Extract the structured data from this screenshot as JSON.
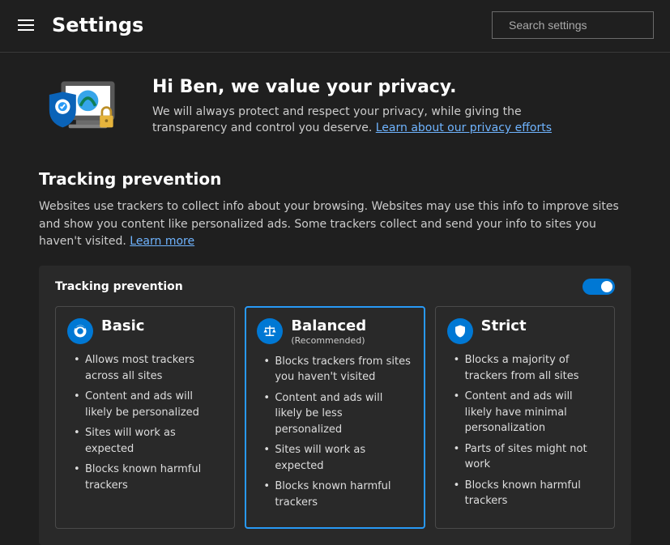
{
  "header": {
    "title": "Settings",
    "search_placeholder": "Search settings"
  },
  "intro": {
    "heading": "Hi Ben, we value your privacy.",
    "body_before_link": "We will always protect and respect your privacy, while giving the transparency and control you deserve. ",
    "link_text": "Learn about our privacy efforts"
  },
  "tracking": {
    "section_title": "Tracking prevention",
    "desc_before_link": "Websites use trackers to collect info about your browsing. Websites may use this info to improve sites and show you content like personalized ads. Some trackers collect and send your info to sites you haven't visited. ",
    "learn_more": "Learn more",
    "panel_label": "Tracking prevention",
    "toggle_on": true,
    "cards": [
      {
        "id": "basic",
        "title": "Basic",
        "subtitle": "",
        "selected": false,
        "icon": "eye",
        "bullets": [
          "Allows most trackers across all sites",
          "Content and ads will likely be personalized",
          "Sites will work as expected",
          "Blocks known harmful trackers"
        ]
      },
      {
        "id": "balanced",
        "title": "Balanced",
        "subtitle": "(Recommended)",
        "selected": true,
        "icon": "scale",
        "bullets": [
          "Blocks trackers from sites you haven't visited",
          "Content and ads will likely be less personalized",
          "Sites will work as expected",
          "Blocks known harmful trackers"
        ]
      },
      {
        "id": "strict",
        "title": "Strict",
        "subtitle": "",
        "selected": false,
        "icon": "shield",
        "bullets": [
          "Blocks a majority of trackers from all sites",
          "Content and ads will likely have minimal personalization",
          "Parts of sites might not work",
          "Blocks known harmful trackers"
        ]
      }
    ]
  }
}
